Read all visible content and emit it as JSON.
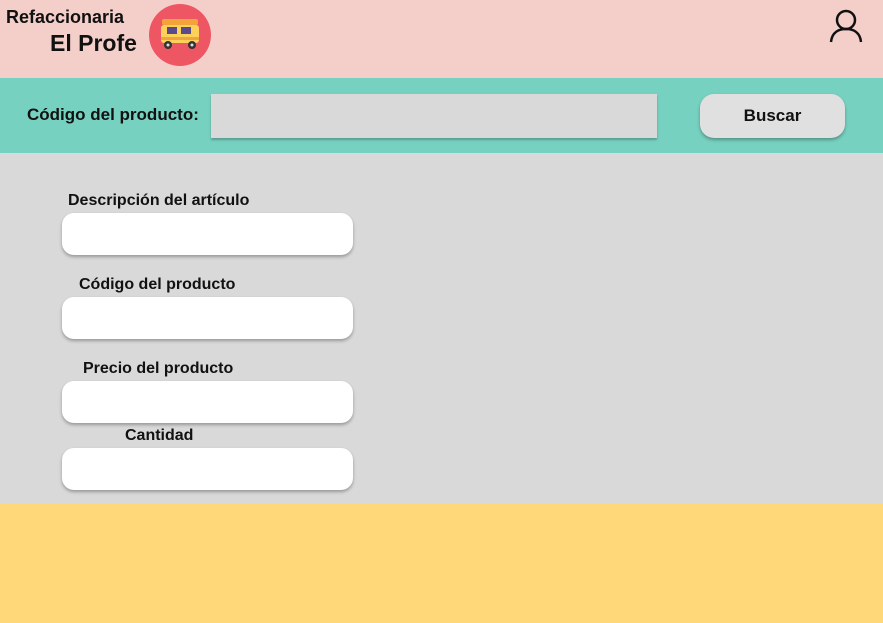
{
  "header": {
    "brand_line1": "Refaccionaria",
    "brand_line2": "El Profe",
    "logo_icon": "auto-rickshaw-icon",
    "user_icon": "user-profile-icon"
  },
  "search": {
    "label": "Código del producto:",
    "input_value": "",
    "button_label": "Buscar"
  },
  "form": {
    "fields": [
      {
        "label": "Descripción del artículo",
        "value": ""
      },
      {
        "label": "Código del producto",
        "value": ""
      },
      {
        "label": "Precio del producto",
        "value": ""
      },
      {
        "label": "Cantidad",
        "value": ""
      }
    ]
  },
  "colors": {
    "header_bg": "#f4cfca",
    "searchbar_bg": "#77d1c0",
    "content_bg": "#d9d9d9",
    "footer_bg": "#fed879",
    "logo_bg": "#ef5664"
  }
}
